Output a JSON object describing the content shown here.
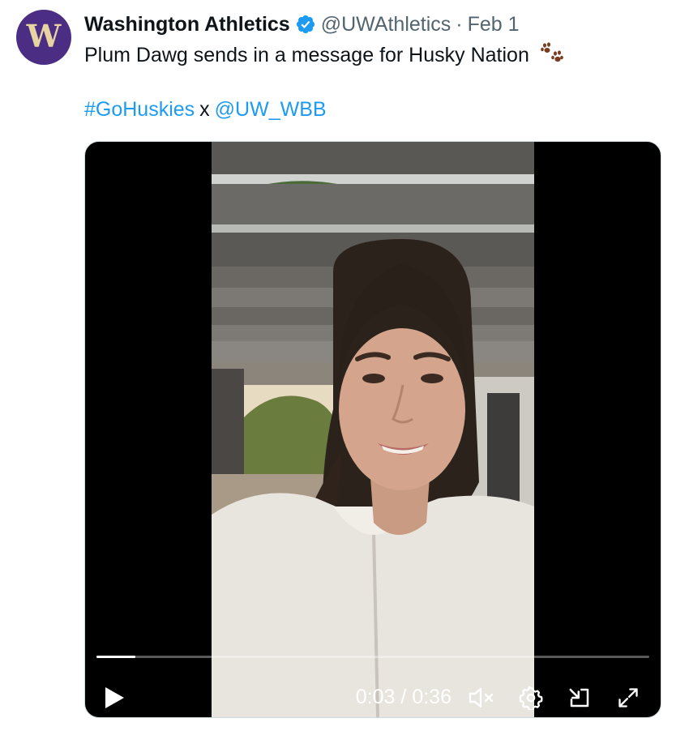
{
  "tweet": {
    "author_name": "Washington Athletics",
    "handle": "@UWAthletics",
    "separator": "·",
    "date": "Feb 1",
    "text": "Plum Dawg sends in a message for Husky Nation",
    "hashtag": "#GoHuskies",
    "joiner": "x",
    "mention": "@UW_WBB",
    "avatar_letter": "W"
  },
  "colors": {
    "brand_purple": "#4b2e83",
    "link_blue": "#1d9bf0",
    "verified_blue": "#1d9bf0",
    "paw_brown": "#7a3b1e"
  },
  "video": {
    "current_time": "0:03",
    "duration": "0:36",
    "time_display": "0:03 / 0:36",
    "progress": 0.07,
    "muted": true,
    "controls": [
      "play-icon",
      "mute-icon",
      "settings-gear-icon",
      "picture-in-picture-icon",
      "fullscreen-icon"
    ]
  }
}
